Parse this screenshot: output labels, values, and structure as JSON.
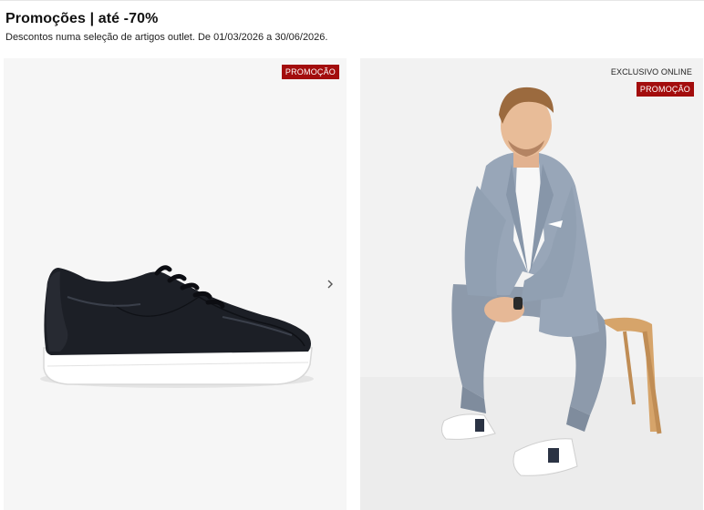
{
  "header": {
    "title": "Promoções | até -70%",
    "subtitle": "Descontos numa seleção de artigos outlet. De 01/03/2026 a 30/06/2026."
  },
  "products": [
    {
      "badge": "PROMOÇÃO",
      "image": "black-leather-sneaker",
      "arrow_icon": "chevron-right-icon"
    },
    {
      "badge": "PROMOÇÃO",
      "tag": "EXCLUSIVO ONLINE",
      "image": "man-in-grey-suit-on-stool"
    }
  ],
  "colors": {
    "badge": "#a30d0d",
    "card_bg": "#f6f6f6"
  }
}
